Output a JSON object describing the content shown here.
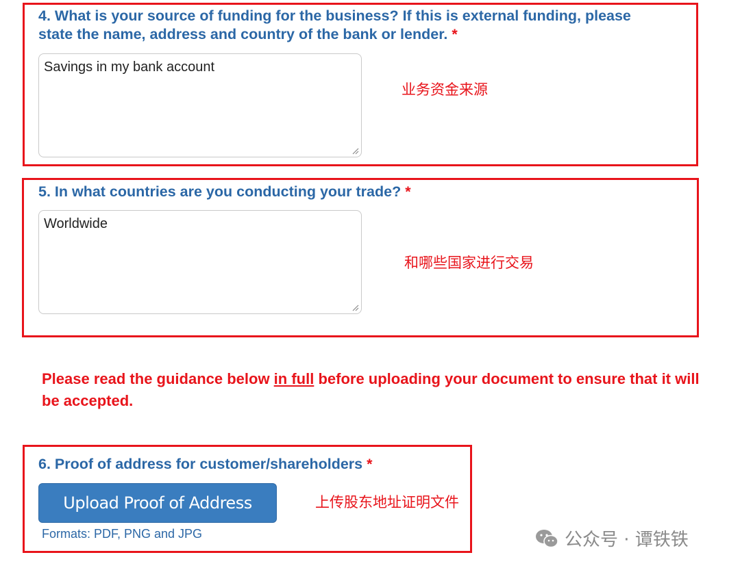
{
  "q4": {
    "number": "4.",
    "line1": "4. What is your source of funding for the business? If this is external funding, please",
    "line2": "state the name, address and country of the bank or lender.",
    "required": "*",
    "answer": "Savings in my bank account",
    "annotation": "业务资金来源"
  },
  "q5": {
    "title": "5. In what countries are you conducting your trade?",
    "required": "*",
    "answer": "Worldwide",
    "annotation": "和哪些国家进行交易"
  },
  "guidance": {
    "before": "Please read the guidance below ",
    "underlined": "in full",
    "after": " before uploading your document to ensure that it will be accepted."
  },
  "q6": {
    "title": "6. Proof of address for customer/shareholders",
    "required": "*",
    "button_label": "Upload Proof of Address",
    "formats": "Formats: PDF, PNG and JPG",
    "annotation": "上传股东地址证明文件"
  },
  "watermark": {
    "text": "公众号 · 谭铁铁",
    "icon": "wechat-icon"
  },
  "colors": {
    "question_blue": "#2b67a6",
    "annotation_red": "#e8141b",
    "button_blue": "#3a7dbf"
  }
}
